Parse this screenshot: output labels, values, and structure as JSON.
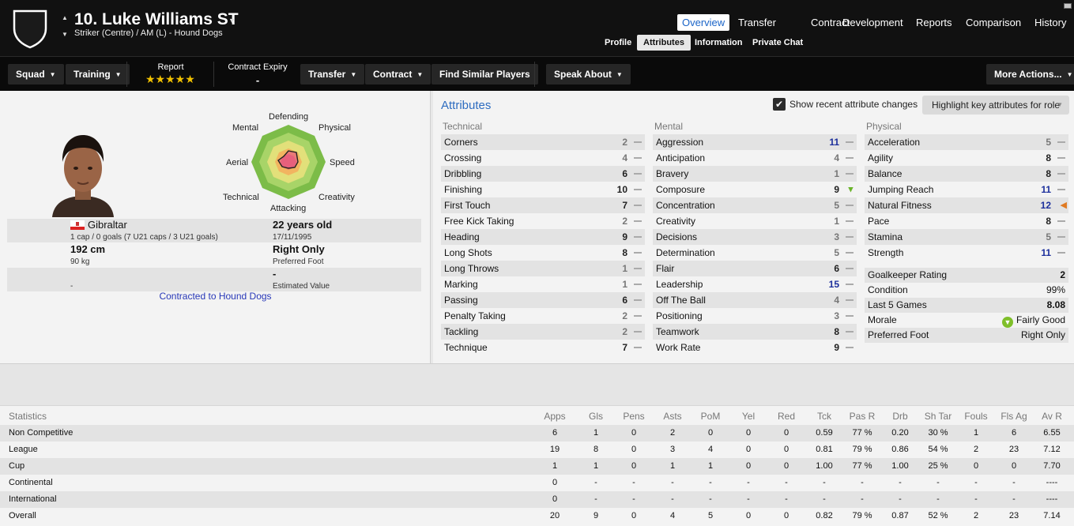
{
  "header": {
    "player_name": "10. Luke Williams ST",
    "subtitle": "Striker (Centre) / AM (L) - Hound Dogs",
    "main_tabs": [
      "Overview",
      "Transfer",
      "Contract",
      "Development",
      "Reports",
      "Comparison",
      "History"
    ],
    "active_main_tab": "Overview",
    "sub_tabs": [
      "Profile",
      "Attributes",
      "Information",
      "Private Chat"
    ],
    "active_sub_tab": "Attributes"
  },
  "toolbar": {
    "squad": "Squad",
    "training": "Training",
    "report_label": "Report",
    "report_stars": "★★★★★",
    "contract_expiry_label": "Contract Expiry",
    "contract_expiry_value": "-",
    "transfer": "Transfer",
    "contract": "Contract",
    "find_similar": "Find Similar Players",
    "speak_about": "Speak About",
    "more_actions": "More Actions..."
  },
  "profile": {
    "radar_labels": {
      "defending": "Defending",
      "physical": "Physical",
      "speed": "Speed",
      "creativity": "Creativity",
      "attacking": "Attacking",
      "technical": "Technical",
      "aerial": "Aerial",
      "mental": "Mental"
    },
    "nationality": "Gibraltar",
    "caps": "1 cap / 0 goals (7 U21 caps / 3 U21 goals)",
    "age": "22 years old",
    "dob": "17/11/1995",
    "height": "192 cm",
    "weight": "90 kg",
    "preferred_foot": "Right Only",
    "preferred_foot_label": "Preferred Foot",
    "estimated_value": "-",
    "estimated_value_label": "Estimated Value",
    "left_bottom": "-",
    "contracted": "Contracted to Hound Dogs"
  },
  "attributes": {
    "title": "Attributes",
    "show_changes_label": "Show recent attribute changes",
    "highlight_label": "Highlight key attributes for role",
    "technical_title": "Technical",
    "mental_title": "Mental",
    "physical_title": "Physical",
    "technical": [
      {
        "name": "Corners",
        "value": "2"
      },
      {
        "name": "Crossing",
        "value": "4"
      },
      {
        "name": "Dribbling",
        "value": "6"
      },
      {
        "name": "Finishing",
        "value": "10"
      },
      {
        "name": "First Touch",
        "value": "7"
      },
      {
        "name": "Free Kick Taking",
        "value": "2"
      },
      {
        "name": "Heading",
        "value": "9"
      },
      {
        "name": "Long Shots",
        "value": "8"
      },
      {
        "name": "Long Throws",
        "value": "1"
      },
      {
        "name": "Marking",
        "value": "1"
      },
      {
        "name": "Passing",
        "value": "6"
      },
      {
        "name": "Penalty Taking",
        "value": "2"
      },
      {
        "name": "Tackling",
        "value": "2"
      },
      {
        "name": "Technique",
        "value": "7"
      }
    ],
    "mental": [
      {
        "name": "Aggression",
        "value": "11"
      },
      {
        "name": "Anticipation",
        "value": "4"
      },
      {
        "name": "Bravery",
        "value": "1"
      },
      {
        "name": "Composure",
        "value": "9"
      },
      {
        "name": "Concentration",
        "value": "5"
      },
      {
        "name": "Creativity",
        "value": "1"
      },
      {
        "name": "Decisions",
        "value": "3"
      },
      {
        "name": "Determination",
        "value": "5"
      },
      {
        "name": "Flair",
        "value": "6"
      },
      {
        "name": "Leadership",
        "value": "15"
      },
      {
        "name": "Off The Ball",
        "value": "4"
      },
      {
        "name": "Positioning",
        "value": "3"
      },
      {
        "name": "Teamwork",
        "value": "8"
      },
      {
        "name": "Work Rate",
        "value": "9"
      }
    ],
    "physical": [
      {
        "name": "Acceleration",
        "value": "5"
      },
      {
        "name": "Agility",
        "value": "8"
      },
      {
        "name": "Balance",
        "value": "8"
      },
      {
        "name": "Jumping Reach",
        "value": "11"
      },
      {
        "name": "Natural Fitness",
        "value": "12"
      },
      {
        "name": "Pace",
        "value": "8"
      },
      {
        "name": "Stamina",
        "value": "5"
      },
      {
        "name": "Strength",
        "value": "11"
      }
    ],
    "summary": [
      {
        "name": "Goalkeeper Rating",
        "value": "2"
      },
      {
        "name": "Condition",
        "value": "99%"
      },
      {
        "name": "Last 5 Games",
        "value": "8.08"
      },
      {
        "name": "Morale",
        "value": "Fairly Good"
      },
      {
        "name": "Preferred Foot",
        "value": "Right Only"
      }
    ]
  },
  "statistics": {
    "title": "Statistics",
    "columns": [
      "Apps",
      "Gls",
      "Pens",
      "Asts",
      "PoM",
      "Yel",
      "Red",
      "Tck",
      "Pas R",
      "Drb",
      "Sh Tar",
      "Fouls",
      "Fls Ag",
      "Av R"
    ],
    "rows": [
      {
        "label": "Non Competitive",
        "values": [
          "6",
          "1",
          "0",
          "2",
          "0",
          "0",
          "0",
          "0.59",
          "77 %",
          "0.20",
          "30 %",
          "1",
          "6",
          "6.55"
        ]
      },
      {
        "label": "League",
        "values": [
          "19",
          "8",
          "0",
          "3",
          "4",
          "0",
          "0",
          "0.81",
          "79 %",
          "0.86",
          "54 %",
          "2",
          "23",
          "7.12"
        ]
      },
      {
        "label": "Cup",
        "values": [
          "1",
          "1",
          "0",
          "1",
          "1",
          "0",
          "0",
          "1.00",
          "77 %",
          "1.00",
          "25 %",
          "0",
          "0",
          "7.70"
        ]
      },
      {
        "label": "Continental",
        "values": [
          "0",
          "-",
          "-",
          "-",
          "-",
          "-",
          "-",
          "-",
          "-",
          "-",
          "-",
          "-",
          "-",
          "----"
        ]
      },
      {
        "label": "International",
        "values": [
          "0",
          "-",
          "-",
          "-",
          "-",
          "-",
          "-",
          "-",
          "-",
          "-",
          "-",
          "-",
          "-",
          "----"
        ]
      },
      {
        "label": "Overall",
        "values": [
          "20",
          "9",
          "0",
          "4",
          "5",
          "0",
          "0",
          "0.82",
          "79 %",
          "0.87",
          "52 %",
          "2",
          "23",
          "7.14"
        ]
      }
    ]
  },
  "colors": {
    "header_bg": "#111111",
    "accent_blue": "#2d6cc0",
    "high_value": "#1c2f9c",
    "morale_green": "#7fbf2a",
    "stars": "#f2c200"
  }
}
